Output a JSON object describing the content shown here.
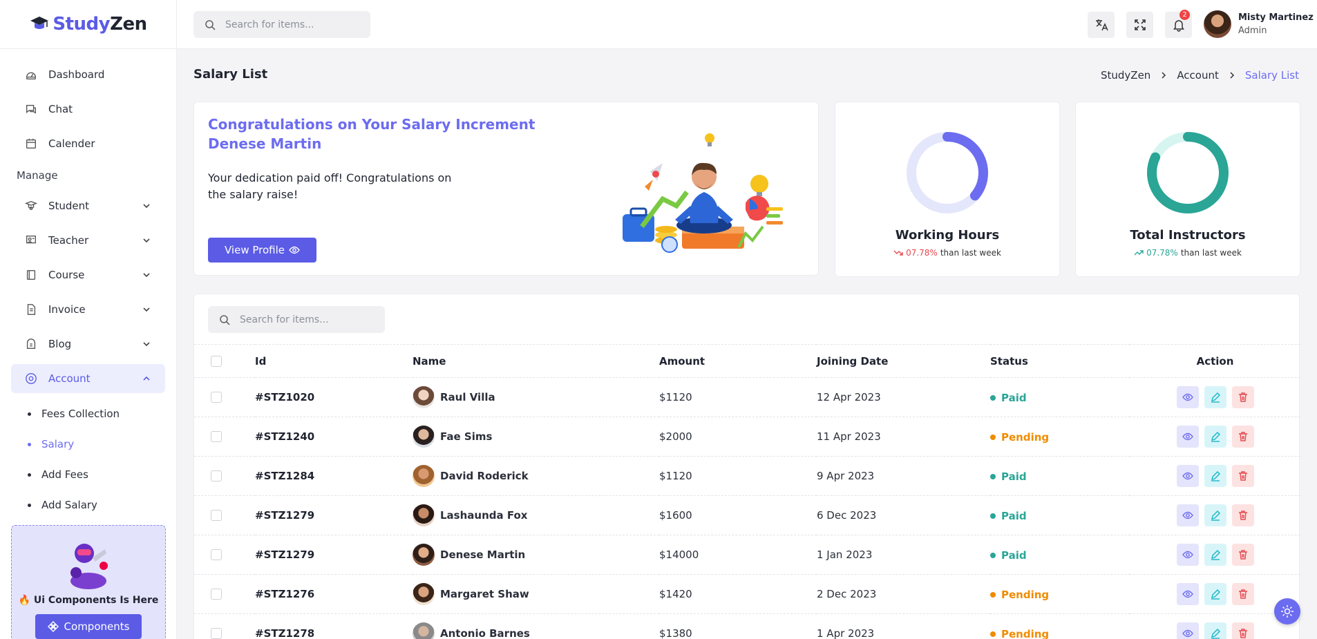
{
  "brand": {
    "part1": "Study",
    "part2": "Zen"
  },
  "sidebar": {
    "items": [
      {
        "label": "Dashboard",
        "icon": "dashboard-icon"
      },
      {
        "label": "Chat",
        "icon": "chat-icon"
      },
      {
        "label": "Calender",
        "icon": "calendar-icon"
      }
    ],
    "section_label": "Manage",
    "manage_items": [
      {
        "label": "Student",
        "icon": "student-icon"
      },
      {
        "label": "Teacher",
        "icon": "teacher-icon"
      },
      {
        "label": "Course",
        "icon": "book-icon"
      },
      {
        "label": "Invoice",
        "icon": "invoice-icon"
      },
      {
        "label": "Blog",
        "icon": "blog-icon"
      },
      {
        "label": "Account",
        "icon": "account-icon",
        "active": true
      }
    ],
    "account_sub": [
      {
        "label": "Fees Collection"
      },
      {
        "label": "Salary",
        "active": true
      },
      {
        "label": "Add Fees"
      },
      {
        "label": "Add Salary"
      }
    ],
    "promo": {
      "text": "🔥 Ui Components Is Here",
      "button": "Components"
    }
  },
  "topbar": {
    "search_placeholder": "Search for items...",
    "notification_count": "2",
    "user_name": "Misty Martinez",
    "user_role": "Admin"
  },
  "page": {
    "title": "Salary List",
    "breadcrumb": [
      "StudyZen",
      "Account",
      "Salary List"
    ]
  },
  "congrats": {
    "title": "Congratulations on Your Salary Increment Denese Martin",
    "text": "Your dedication paid off! Congratulations on the salary raise!",
    "button": "View Profile"
  },
  "stats": [
    {
      "title": "Working Hours",
      "trend_value": "07.78%",
      "trend_text": "than last week",
      "direction": "down",
      "progress": 0.36,
      "color": "#6c6cf0",
      "track": "#e4e6fb"
    },
    {
      "title": "Total Instructors",
      "trend_value": "07.78%",
      "trend_text": "than last week",
      "direction": "up",
      "progress": 0.82,
      "color": "#2aa596",
      "track": "#d6f5f1"
    }
  ],
  "table": {
    "search_placeholder": "Search for items...",
    "headers": [
      "Id",
      "Name",
      "Amount",
      "Joining Date",
      "Status",
      "Action"
    ],
    "rows": [
      {
        "id": "#STZ1020",
        "name": "Raul Villa",
        "amount": "$1120",
        "date": "12 Apr 2023",
        "status": "Paid"
      },
      {
        "id": "#STZ1240",
        "name": "Fae Sims",
        "amount": "$2000",
        "date": "11 Apr 2023",
        "status": "Pending"
      },
      {
        "id": "#STZ1284",
        "name": "David Roderick",
        "amount": "$1120",
        "date": "9 Apr 2023",
        "status": "Paid"
      },
      {
        "id": "#STZ1279",
        "name": "Lashaunda Fox",
        "amount": "$1600",
        "date": "6 Dec 2023",
        "status": "Paid"
      },
      {
        "id": "#STZ1279",
        "name": "Denese Martin",
        "amount": "$14000",
        "date": "1 Jan 2023",
        "status": "Paid"
      },
      {
        "id": "#STZ1276",
        "name": "Margaret Shaw",
        "amount": "$1420",
        "date": "2 Dec 2023",
        "status": "Pending"
      },
      {
        "id": "#STZ1278",
        "name": "Antonio Barnes",
        "amount": "$1380",
        "date": "1 Apr 2023",
        "status": "Pending"
      }
    ]
  },
  "colors": {
    "accent": "#5b5be6",
    "paid": "#2aa596",
    "pending": "#f08c00",
    "danger": "#e5484d"
  }
}
